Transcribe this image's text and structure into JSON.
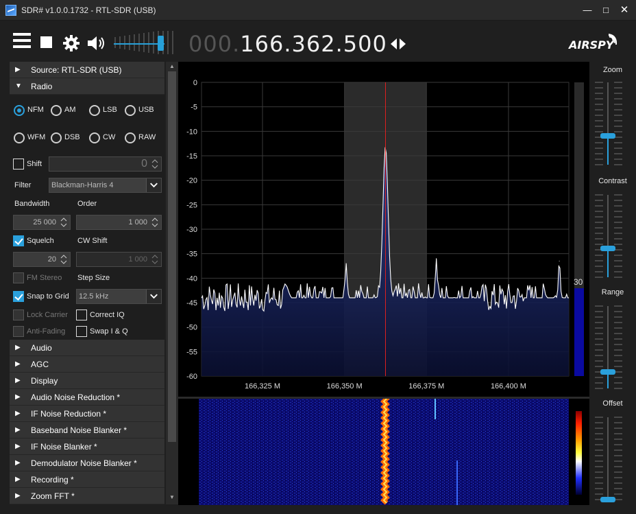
{
  "window": {
    "title": "SDR# v1.0.0.1732 - RTL-SDR (USB)",
    "min": "—",
    "max": "□",
    "close": "✕"
  },
  "toolbar": {
    "freq_dim": "000.",
    "freq_main": "166.362.500",
    "brand": "AIRSPY",
    "volume_level": 0.9
  },
  "panel": {
    "source_label": "Source: RTL-SDR (USB)",
    "radio_label": "Radio",
    "modes_row1": [
      "NFM",
      "AM",
      "LSB",
      "USB"
    ],
    "modes_row2": [
      "WFM",
      "DSB",
      "CW",
      "RAW"
    ],
    "selected_mode": "NFM",
    "shift_label": "Shift",
    "shift_value": "0",
    "filter_label": "Filter",
    "filter_value": "Blackman-Harris 4",
    "bandwidth_label": "Bandwidth",
    "order_label": "Order",
    "bandwidth_value": "25 000",
    "order_value": "1 000",
    "squelch_label": "Squelch",
    "cwshift_label": "CW Shift",
    "squelch_value": "20",
    "cwshift_value": "1 000",
    "fmstereo_label": "FM Stereo",
    "stepsize_label": "Step Size",
    "snap_label": "Snap to Grid",
    "step_value": "12.5 kHz",
    "lockcarrier_label": "Lock Carrier",
    "correctiq_label": "Correct IQ",
    "antifading_label": "Anti-Fading",
    "swapiq_label": "Swap I & Q",
    "sections": [
      "Audio",
      "AGC",
      "Display",
      "Audio Noise Reduction *",
      "IF Noise Reduction *",
      "Baseband Noise Blanker *",
      "IF Noise Blanker *",
      "Demodulator Noise Blanker *",
      "Recording *",
      "Zoom FFT *"
    ]
  },
  "right": {
    "zoom": "Zoom",
    "contrast": "Contrast",
    "range": "Range",
    "offset": "Offset",
    "zoom_level": 0.35,
    "contrast_level": 0.35,
    "range_level": 0.2,
    "offset_level": 0.0
  },
  "chart_data": {
    "type": "line",
    "title": "",
    "xlabel": "",
    "ylabel": "",
    "ylim": [
      -60,
      0
    ],
    "yticks": [
      "0",
      "-5",
      "-10",
      "-15",
      "-20",
      "-25",
      "-30",
      "-35",
      "-40",
      "-45",
      "-50",
      "-55",
      "-60"
    ],
    "xticks": [
      "166,325 M",
      "166,350 M",
      "166,375 M",
      "166,400 M"
    ],
    "xtick_values": [
      166.325,
      166.35,
      166.375,
      166.4
    ],
    "xlim": [
      166.3064,
      166.4184
    ],
    "center_freq": 166.3625,
    "filter_band": [
      166.35,
      166.375
    ],
    "noise_floor_db": -44,
    "peaks": [
      {
        "x": 166.3625,
        "y": -13
      },
      {
        "x": 166.3505,
        "y": -37
      },
      {
        "x": 166.378,
        "y": -36
      },
      {
        "x": 166.4155,
        "y": -36.5
      }
    ],
    "level_indicator": "30"
  }
}
